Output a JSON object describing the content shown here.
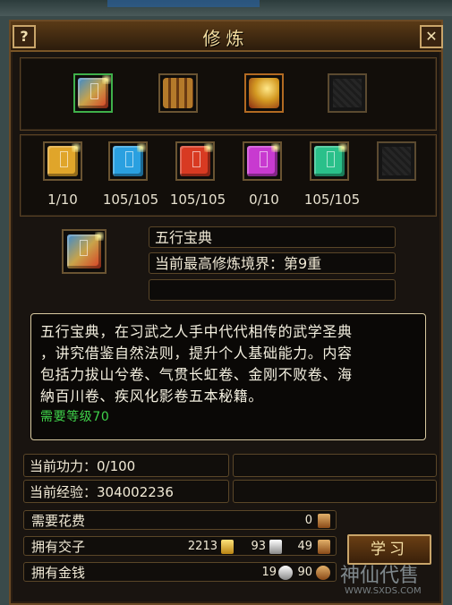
{
  "window": {
    "title": "修炼",
    "help_label": "?",
    "close_label": "✕"
  },
  "categories": [
    {
      "name": "book-bundle-icon",
      "color": "#c8a34a",
      "selected": true
    },
    {
      "name": "scroll-bundle-icon",
      "color": "#8a5a22",
      "selected": false
    },
    {
      "name": "treasure-chest-icon",
      "color": "#d49a22",
      "selected": false
    },
    {
      "name": "empty-slot",
      "color": "#1a1a1a",
      "selected": false
    }
  ],
  "skills": [
    {
      "count": "1/10",
      "color": "#e0a52a",
      "icon": "yellow-book-icon"
    },
    {
      "count": "105/105",
      "color": "#2aa0e0",
      "icon": "blue-book-icon"
    },
    {
      "count": "105/105",
      "color": "#d83a22",
      "icon": "red-book-icon"
    },
    {
      "count": "0/10",
      "color": "#c83ad0",
      "icon": "purple-book-icon"
    },
    {
      "count": "105/105",
      "color": "#2ac08a",
      "icon": "green-book-icon"
    },
    {
      "count": "",
      "color": "#1a1a1a",
      "icon": "empty-slot"
    }
  ],
  "selected": {
    "name": "五行宝典",
    "realm": "当前最高修炼境界：第9重",
    "extra": ""
  },
  "description": {
    "lines": [
      "五行宝典，在习武之人手中代代相传的武学圣典",
      "，讲究借鉴自然法则，提升个人基础能力。内容",
      "包括力拔山兮卷、气贯长虹卷、金刚不败卷、海",
      "納百川卷、疾风化影卷五本秘籍。"
    ],
    "requirement": "需要等级70"
  },
  "stats": {
    "power": "当前功力：0/100",
    "exp": "当前经验：304002236"
  },
  "cost": {
    "label": "需要花费",
    "value": "0"
  },
  "jiaozi": {
    "label": "拥有交子",
    "gold": "2213",
    "silver": "93",
    "copper": "49"
  },
  "money": {
    "label": "拥有金钱",
    "gold": "19",
    "silver": "90"
  },
  "learn_label": "学习",
  "watermark": {
    "brand": "神仙代售",
    "url": "WWW.SXDS.COM"
  }
}
